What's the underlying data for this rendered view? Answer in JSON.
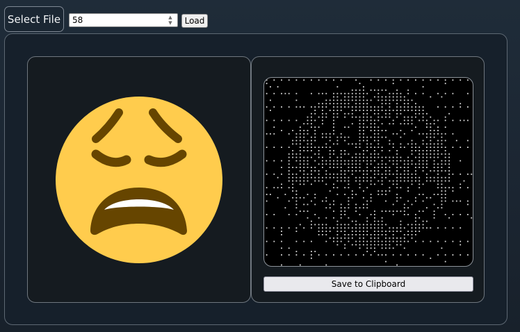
{
  "toolbar": {
    "select_file_label": "Select File",
    "number_value": "58",
    "load_label": "Load"
  },
  "preview": {
    "emoji": "weary-face",
    "face_color": "#FFCC4D",
    "feature_color": "#664500"
  },
  "ascii": {
    "dot_color": "#d8d8d8",
    "background": "#000000"
  },
  "actions": {
    "save_label": "Save to Clipboard"
  }
}
